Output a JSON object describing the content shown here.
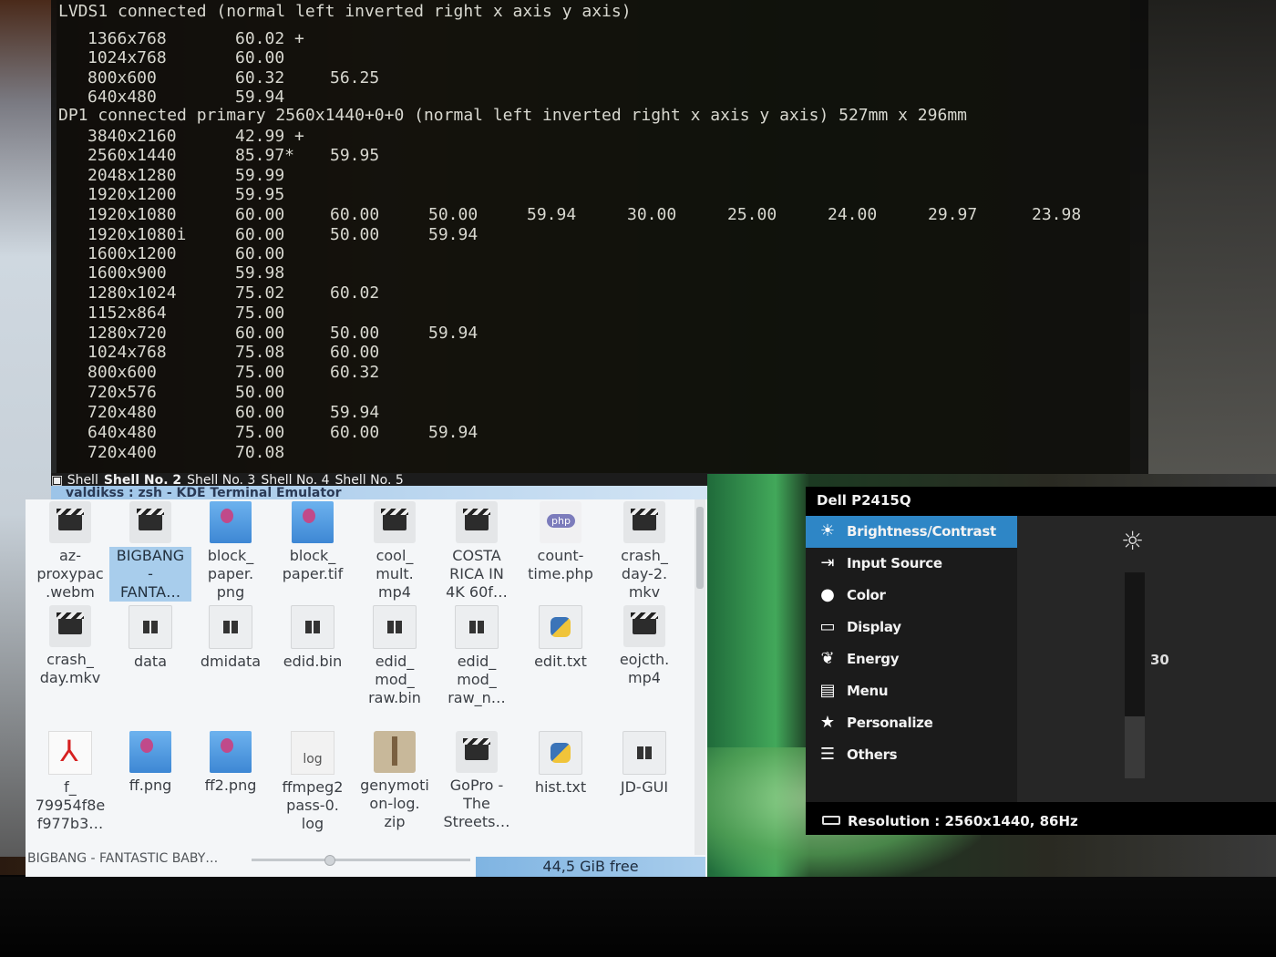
{
  "terminal": {
    "lines": [
      {
        "text": "LVDS1 connected (normal left inverted right x axis y axis)"
      },
      {
        "text": "DP1 connected primary 2560x1440+0+0 (normal left inverted right x axis y axis) 527mm x 296mm"
      }
    ],
    "modes": [
      {
        "res": "1366x768",
        "rates": [
          "60.02 +"
        ]
      },
      {
        "res": "1024x768",
        "rates": [
          "60.00"
        ]
      },
      {
        "res": "800x600",
        "rates": [
          "60.32",
          "56.25"
        ]
      },
      {
        "res": "640x480",
        "rates": [
          "59.94"
        ]
      },
      {
        "res": "3840x2160",
        "rates": [
          "42.99 +"
        ]
      },
      {
        "res": "2560x1440",
        "rates": [
          "85.97*",
          "59.95"
        ]
      },
      {
        "res": "2048x1280",
        "rates": [
          "59.99"
        ]
      },
      {
        "res": "1920x1200",
        "rates": [
          "59.95"
        ]
      },
      {
        "res": "1920x1080",
        "rates": [
          "60.00",
          "60.00",
          "50.00",
          "59.94",
          "30.00",
          "25.00",
          "24.00",
          "29.97",
          "23.98"
        ]
      },
      {
        "res": "1920x1080i",
        "rates": [
          "60.00",
          "50.00",
          "59.94"
        ]
      },
      {
        "res": "1600x1200",
        "rates": [
          "60.00"
        ]
      },
      {
        "res": "1600x900",
        "rates": [
          "59.98"
        ]
      },
      {
        "res": "1280x1024",
        "rates": [
          "75.02",
          "60.02"
        ]
      },
      {
        "res": "1152x864",
        "rates": [
          "75.00"
        ]
      },
      {
        "res": "1280x720",
        "rates": [
          "60.00",
          "50.00",
          "59.94"
        ]
      },
      {
        "res": "1024x768",
        "rates": [
          "75.08",
          "60.00"
        ]
      },
      {
        "res": "800x600",
        "rates": [
          "75.00",
          "60.32"
        ]
      },
      {
        "res": "720x576",
        "rates": [
          "50.00"
        ]
      },
      {
        "res": "720x480",
        "rates": [
          "60.00",
          "59.94"
        ]
      },
      {
        "res": "640x480",
        "rates": [
          "75.00",
          "60.00",
          "59.94"
        ]
      },
      {
        "res": "720x400",
        "rates": [
          "70.08"
        ]
      }
    ],
    "tabs": [
      "Shell",
      "Shell No. 2",
      "Shell No. 3",
      "Shell No. 4",
      "Shell No. 5"
    ],
    "active_tab": 1,
    "window_title": "valdikss : zsh - KDE Terminal Emulator"
  },
  "file_manager": {
    "files": [
      {
        "label": "az-\nproxypac\n.webm",
        "icon": "video-icon",
        "selected": false
      },
      {
        "label": "BIGBANG\n-\nFANTA…",
        "icon": "video-icon",
        "selected": true
      },
      {
        "label": "block_\npaper.\npng",
        "icon": "image-icon",
        "selected": false
      },
      {
        "label": "block_\npaper.tif",
        "icon": "image-icon",
        "selected": false
      },
      {
        "label": "cool_\nmult.\nmp4",
        "icon": "video-icon",
        "selected": false
      },
      {
        "label": "COSTA\nRICA IN\n4K 60f…",
        "icon": "video-icon",
        "selected": false
      },
      {
        "label": "count-\ntime.php",
        "icon": "php-icon",
        "selected": false
      },
      {
        "label": "crash_\nday-2.\nmkv",
        "icon": "video-icon",
        "selected": false
      },
      {
        "label": "crash_\nday.mkv",
        "icon": "video-icon",
        "selected": false
      },
      {
        "label": "data",
        "icon": "binary-icon",
        "selected": false
      },
      {
        "label": "dmidata",
        "icon": "binary-icon",
        "selected": false
      },
      {
        "label": "edid.bin",
        "icon": "binary-icon",
        "selected": false
      },
      {
        "label": "edid_\nmod_\nraw.bin",
        "icon": "binary-icon",
        "selected": false
      },
      {
        "label": "edid_\nmod_\nraw_n…",
        "icon": "binary-icon",
        "selected": false
      },
      {
        "label": "edit.txt",
        "icon": "python-icon",
        "selected": false
      },
      {
        "label": "eojcth.\nmp4",
        "icon": "video-icon",
        "selected": false
      },
      {
        "label": "f_\n79954f8e\nf977b3…",
        "icon": "pdf-icon",
        "selected": false
      },
      {
        "label": "ff.png",
        "icon": "image-icon",
        "selected": false
      },
      {
        "label": "ff2.png",
        "icon": "image-icon",
        "selected": false
      },
      {
        "label": "ffmpeg2\npass-0.\nlog",
        "icon": "log-icon",
        "selected": false
      },
      {
        "label": "genymoti\non-log.\nzip",
        "icon": "zip-icon",
        "selected": false
      },
      {
        "label": "GoPro -\nThe\nStreets…",
        "icon": "video-icon",
        "selected": false
      },
      {
        "label": "hist.txt",
        "icon": "python-icon",
        "selected": false
      },
      {
        "label": "JD-GUI",
        "icon": "binary-icon",
        "selected": false
      }
    ],
    "log_icon_text": "log",
    "status_file": "BIGBANG - FANTASTIC BABY…",
    "free_space": "44,5 GiB free"
  },
  "osd": {
    "title": "Dell P2415Q",
    "items": [
      {
        "label": "Brightness/Contrast",
        "icon": "brightness-icon",
        "glyph": "☀"
      },
      {
        "label": "Input Source",
        "icon": "input-source-icon",
        "glyph": "⇥"
      },
      {
        "label": "Color",
        "icon": "color-icon",
        "glyph": "●"
      },
      {
        "label": "Display",
        "icon": "display-icon",
        "glyph": "▭"
      },
      {
        "label": "Energy",
        "icon": "energy-icon",
        "glyph": "❦"
      },
      {
        "label": "Menu",
        "icon": "menu-icon",
        "glyph": "▤"
      },
      {
        "label": "Personalize",
        "icon": "star-icon",
        "glyph": "★"
      },
      {
        "label": "Others",
        "icon": "settings-icon",
        "glyph": "☰"
      }
    ],
    "active_index": 0,
    "brightness_value": "30",
    "brightness_fraction": 0.3,
    "resolution": "Resolution : 2560x1440, 86Hz"
  }
}
